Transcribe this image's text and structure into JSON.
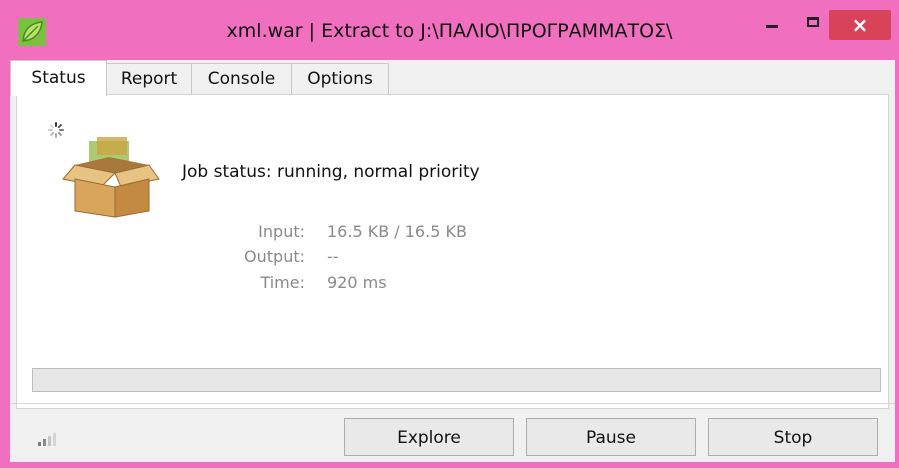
{
  "window": {
    "title": "xml.war | Extract to J:\\ΠΑΛΙΟ\\ΠΡΟΓΡΑΜΜΑΤΟΣ\\",
    "close_glyph": "×",
    "frame_color": "#f06fbe"
  },
  "tabs": [
    {
      "label": "Status",
      "active": true
    },
    {
      "label": "Report",
      "active": false
    },
    {
      "label": "Console",
      "active": false
    },
    {
      "label": "Options",
      "active": false
    }
  ],
  "status": {
    "job_status": "Job status: running, normal priority",
    "stats": [
      {
        "label": "Input:",
        "value": "16.5 KB / 16.5 KB"
      },
      {
        "label": "Output:",
        "value": "--"
      },
      {
        "label": "Time:",
        "value": "920 ms"
      }
    ],
    "progress": 0.0
  },
  "buttons": {
    "explore": "Explore",
    "pause": "Pause",
    "stop": "Stop"
  },
  "icons": {
    "app": "leaf-icon",
    "spinner": "loading-spinner-icon",
    "archive": "open-box-icon",
    "signal": "signal-bars-icon"
  }
}
